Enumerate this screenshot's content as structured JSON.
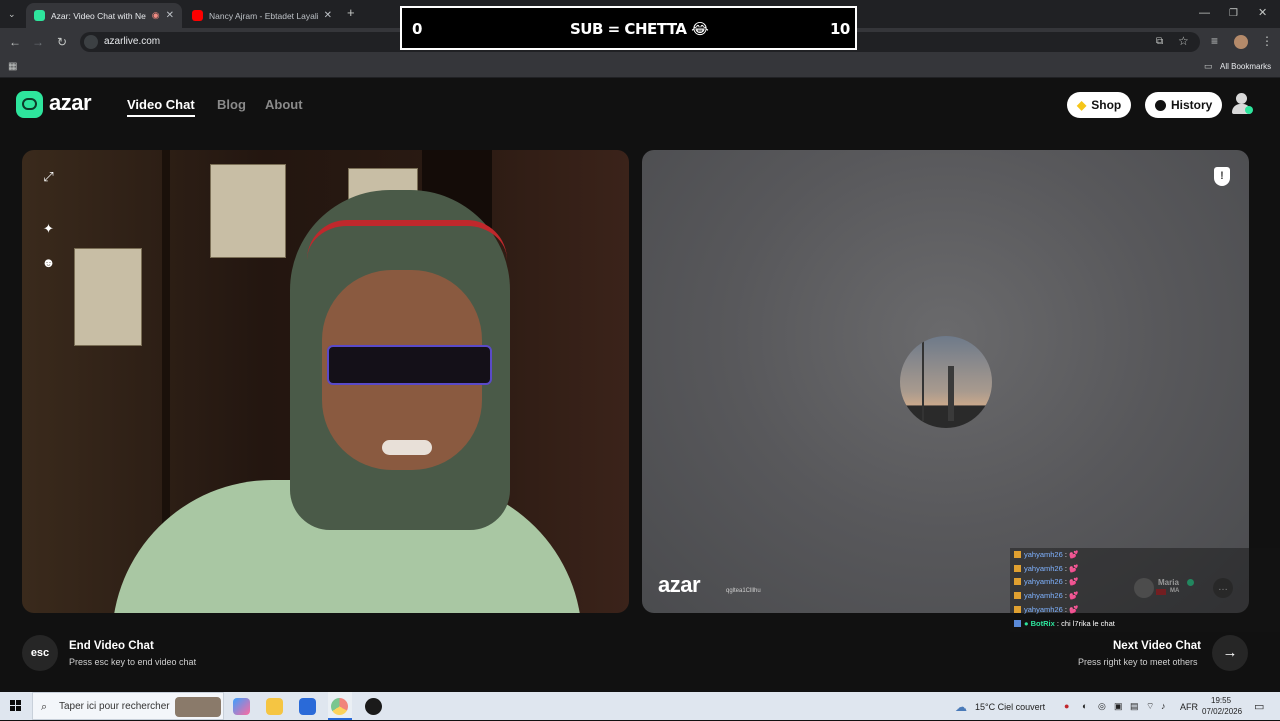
{
  "browser": {
    "tabs": [
      {
        "title": "Azar: Video Chat with New",
        "active": true,
        "favicon_color": "#2ee59d"
      },
      {
        "title": "Nancy Ajram - Ebtadet Layalina",
        "active": false,
        "favicon_color": "#ff0000"
      }
    ],
    "new_tab_icon": "plus-icon",
    "url": "azarlive.com",
    "bookmarks_label": "All Bookmarks",
    "window_controls": [
      "minimize-icon",
      "restore-icon",
      "close-icon"
    ]
  },
  "stream_overlay": {
    "left_count": "0",
    "center_text": "SUB = CHETTA 😂",
    "right_count": "10"
  },
  "header": {
    "logo_text": "azar",
    "nav": [
      {
        "label": "Video Chat",
        "active": true
      },
      {
        "label": "Blog",
        "active": false
      },
      {
        "label": "About",
        "active": false
      }
    ],
    "shop_label": "Shop",
    "history_label": "History",
    "accent_color": "#2ee59d"
  },
  "right_video": {
    "watermark_logo": "azar",
    "watermark_id": "qgltea1Clllhu",
    "peer_name": "Maria",
    "peer_country": "MA"
  },
  "chat": {
    "messages": [
      {
        "user": "yahyamh26",
        "text": "💕"
      },
      {
        "user": "yahyamh26",
        "text": "💕"
      },
      {
        "user": "yahyamh26",
        "text": "💕"
      },
      {
        "user": "yahyamh26",
        "text": "💕"
      },
      {
        "user": "yahyamh26",
        "text": "💕"
      }
    ],
    "bot_user": "BotRix",
    "bot_text": "chi l7rika le chat"
  },
  "bottom": {
    "esc_key": "esc",
    "end_title": "End Video Chat",
    "end_sub": "Press esc key to end video chat",
    "next_title": "Next Video Chat",
    "next_sub": "Press right key to meet others"
  },
  "taskbar": {
    "search_placeholder": "Taper ici pour rechercher",
    "weather": "15°C  Ciel couvert",
    "language": "AFR",
    "time": "19:55",
    "date": "07/02/2026"
  }
}
